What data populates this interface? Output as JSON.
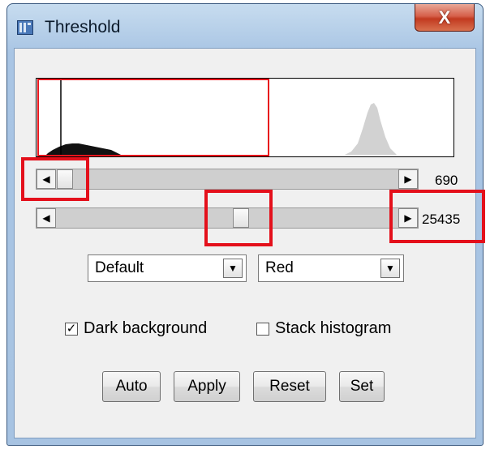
{
  "window": {
    "title": "Threshold",
    "close_glyph": "X",
    "app_icon": "imagej-icon"
  },
  "histogram": {
    "selection_color": "#e8141c",
    "threshold_line_color": "#000000"
  },
  "sliders": {
    "lower": {
      "value": "690",
      "left_arrow": "◀",
      "right_arrow": "▶"
    },
    "upper": {
      "value": "25435",
      "left_arrow": "◀",
      "right_arrow": "▶"
    }
  },
  "dropdowns": {
    "method": {
      "selected": "Default",
      "arrow": "▼"
    },
    "display": {
      "selected": "Red",
      "arrow": "▼"
    }
  },
  "checkboxes": {
    "dark_background": {
      "label": "Dark background",
      "checked": true,
      "mark": "✓"
    },
    "stack_histogram": {
      "label": "Stack histogram",
      "checked": false,
      "mark": ""
    }
  },
  "buttons": {
    "auto": "Auto",
    "apply": "Apply",
    "reset": "Reset",
    "set": "Set"
  },
  "annotation_color": "#e4101b"
}
